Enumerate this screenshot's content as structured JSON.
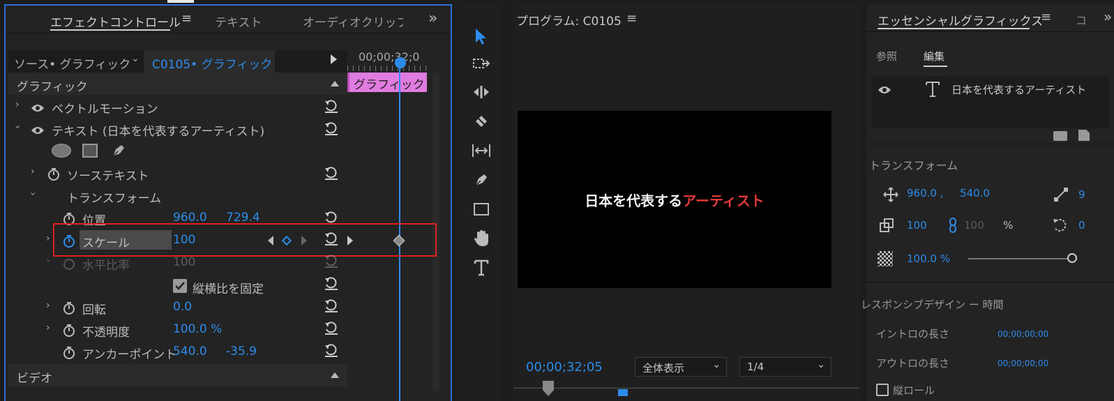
{
  "effects_panel": {
    "tabs": [
      "エフェクトコントロール",
      "テキスト",
      "オーディオクリップ:"
    ],
    "source_label": "ソース• グラフィック",
    "clip_label": "C0105• グラフィック",
    "timeline_timecode": "00;00;32;0",
    "clip_bar_label": "グラフィック",
    "section_graphic": "グラフィック",
    "vector_motion": "ベクトルモーション",
    "text_layer": "テキスト (日本を代表するアーティスト)",
    "source_text": "ソーステキスト",
    "transform": "トランスフォーム",
    "position": {
      "label": "位置",
      "x": "960.0",
      "y": "729.4"
    },
    "scale": {
      "label": "スケール",
      "value": "100"
    },
    "scale_width": {
      "label": "水平比率",
      "value": "100"
    },
    "uniform_scale": "縦横比を固定",
    "rotation": {
      "label": "回転",
      "value": "0.0"
    },
    "opacity": {
      "label": "不透明度",
      "value": "100.0 %"
    },
    "anchor": {
      "label": "アンカーポイント",
      "x": "540.0",
      "y": "-35.9"
    },
    "section_video": "ビデオ"
  },
  "program_panel": {
    "title": "プログラム: C0105",
    "frame_text_white": "日本を代表する",
    "frame_text_red": "アーティスト",
    "timecode": "00;00;32;05",
    "fit_dropdown": "全体表示",
    "resolution_dropdown": "1/4"
  },
  "essential_panel": {
    "title": "エッセンシャルグラフィックス",
    "tabs": [
      "参照",
      "編集"
    ],
    "layer_name": "日本を代表するアーティスト",
    "transform_title": "トランスフォーム",
    "pos_x": "960.0 ,",
    "pos_y": "540.0",
    "pos_extra": "9",
    "scale": "100",
    "scale_locked": "100",
    "scale_unit": "%",
    "rotation": "0",
    "opacity": "100.0 %",
    "responsive_title": "レスポンシブデザイン ー 時間",
    "intro_label": "イントロの長さ",
    "intro_value": "00;00;00;00",
    "outro_label": "アウトロの長さ",
    "outro_value": "00;00;00;00",
    "roll_label": "縦ロール"
  },
  "colors": {
    "accent_blue": "#2d8ceb",
    "highlight_red": "#e02020",
    "clip_pink": "#e07be0",
    "frame_red_text": "#e23a3a"
  }
}
